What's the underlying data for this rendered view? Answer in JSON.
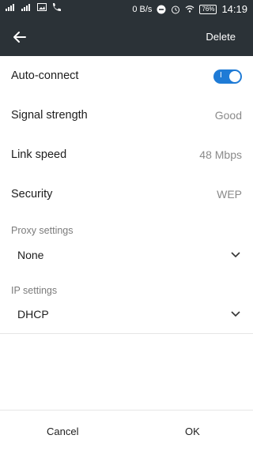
{
  "status": {
    "net_speed": "0 B/s",
    "battery": "76%",
    "time": "14:19"
  },
  "header": {
    "action": "Delete"
  },
  "settings": {
    "auto_connect": {
      "label": "Auto-connect",
      "toggle": "I"
    },
    "signal": {
      "label": "Signal strength",
      "value": "Good"
    },
    "link": {
      "label": "Link speed",
      "value": "48 Mbps"
    },
    "security": {
      "label": "Security",
      "value": "WEP"
    }
  },
  "proxy": {
    "title": "Proxy settings",
    "value": "None"
  },
  "ip": {
    "title": "IP settings",
    "value": "DHCP"
  },
  "footer": {
    "cancel": "Cancel",
    "ok": "OK"
  },
  "colors": {
    "header_bg": "#2b3237",
    "accent": "#1f7bd6"
  }
}
